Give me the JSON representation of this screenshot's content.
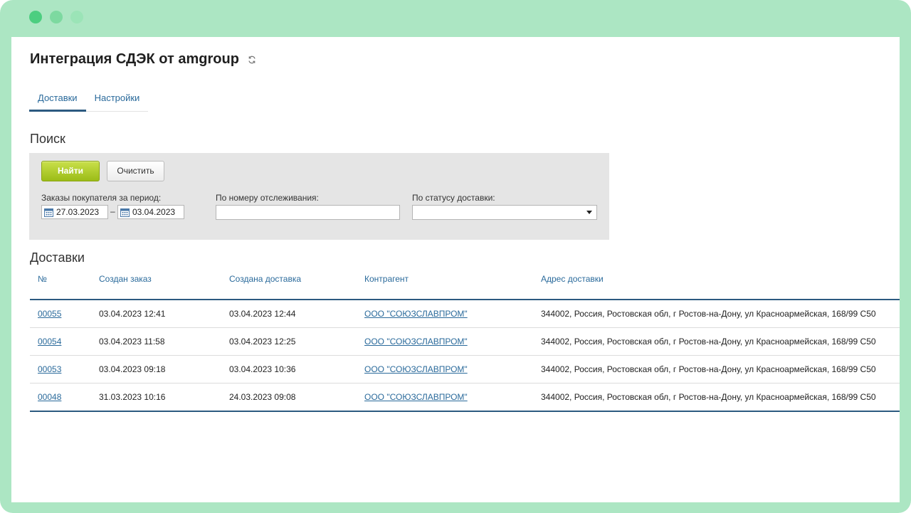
{
  "colors": {
    "frame": "#ace6c3",
    "dot_1": "#4cce80",
    "dot_2": "#7dd9a0",
    "dot_3": "#9be4b7",
    "accent": "#2a6a9b",
    "find_button": "#9bbc17"
  },
  "header": {
    "title": "Интеграция СДЭК от amgroup",
    "refresh_icon": "refresh-icon"
  },
  "tabs": [
    {
      "label": "Доставки",
      "active": true
    },
    {
      "label": "Настройки",
      "active": false
    }
  ],
  "search": {
    "title": "Поиск",
    "find_label": "Найти",
    "clear_label": "Очистить",
    "period_label": "Заказы покупателя за период:",
    "date_from": "27.03.2023",
    "range_separator": "–",
    "date_to": "03.04.2023",
    "tracking_label": "По номеру отслеживания:",
    "tracking_value": "",
    "status_label": "По статусу доставки:",
    "status_value": ""
  },
  "deliveries": {
    "title": "Доставки",
    "columns": [
      "№",
      "Создан заказ",
      "Создана доставка",
      "Контрагент",
      "Адрес доставки"
    ],
    "rows": [
      {
        "number": "00055",
        "order_created": "03.04.2023 12:41",
        "delivery_created": "03.04.2023 12:44",
        "counterparty": "ООО \"СОЮЗСЛАВПРОМ\"",
        "address": "344002, Россия, Ростовская обл, г Ростов-на-Дону, ул Красноармейская, 168/99 С50"
      },
      {
        "number": "00054",
        "order_created": "03.04.2023 11:58",
        "delivery_created": "03.04.2023 12:25",
        "counterparty": "ООО \"СОЮЗСЛАВПРОМ\"",
        "address": "344002, Россия, Ростовская обл, г Ростов-на-Дону, ул Красноармейская, 168/99 С50"
      },
      {
        "number": "00053",
        "order_created": "03.04.2023 09:18",
        "delivery_created": "03.04.2023 10:36",
        "counterparty": "ООО \"СОЮЗСЛАВПРОМ\"",
        "address": "344002, Россия, Ростовская обл, г Ростов-на-Дону, ул Красноармейская, 168/99 С50"
      },
      {
        "number": "00048",
        "order_created": "31.03.2023 10:16",
        "delivery_created": "24.03.2023 09:08",
        "counterparty": "ООО \"СОЮЗСЛАВПРОМ\"",
        "address": "344002, Россия, Ростовская обл, г Ростов-на-Дону, ул Красноармейская, 168/99 С50"
      }
    ]
  }
}
